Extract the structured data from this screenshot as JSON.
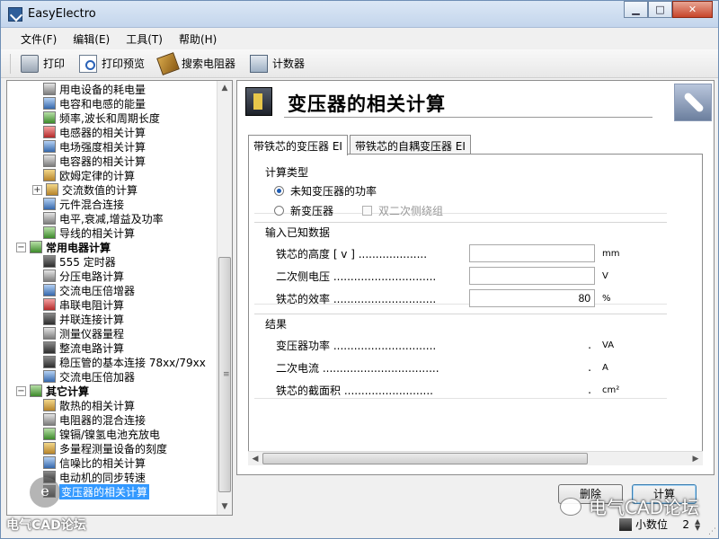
{
  "window": {
    "title": "EasyElectro"
  },
  "menu": [
    "文件(F)",
    "编辑(E)",
    "工具(T)",
    "帮助(H)"
  ],
  "toolbar": {
    "print": "打印",
    "print_preview": "打印预览",
    "search_resistor": "搜索电阻器",
    "counter": "计数器"
  },
  "tree": {
    "items_a": [
      "用电设备的耗电量",
      "电容和电感的能量",
      "频率,波长和周期长度",
      "电感器的相关计算",
      "电场强度相关计算",
      "电容器的相关计算",
      "欧姆定律的计算",
      "交流数值的计算",
      "元件混合连接",
      "电平,衰减,增益及功率",
      "导线的相关计算"
    ],
    "group_common": "常用电器计算",
    "items_b": [
      "555 定时器",
      "分压电路计算",
      "交流电压倍增器",
      "串联电阻计算",
      "并联连接计算",
      "测量仪器量程",
      "整流电路计算",
      "稳压管的基本连接 78xx/79xx",
      "交流电压倍加器"
    ],
    "group_other": "其它计算",
    "items_c": [
      "散热的相关计算",
      "电阻器的混合连接",
      "镍镉/镍氢电池充放电",
      "多量程测量设备的刻度",
      "信噪比的相关计算",
      "电动机的同步转速",
      "变压器的相关计算"
    ]
  },
  "page": {
    "title": "变压器的相关计算",
    "tabs": [
      "带铁芯的变压器 EI",
      "带铁芯的自耦变压器 EI"
    ],
    "calc_type": {
      "title": "计算类型",
      "option_known_power": "未知变压器的功率",
      "option_new": "新变压器",
      "option_dual_secondary": "双二次侧绕组"
    },
    "inputs": {
      "title": "输入已知数据",
      "rows": [
        {
          "label": "铁芯的高度 [ v ] ....................",
          "value": "",
          "unit": "mm"
        },
        {
          "label": "二次侧电压 ..............................",
          "value": "",
          "unit": "V"
        },
        {
          "label": "铁芯的效率 ..............................",
          "value": "80",
          "unit": "%"
        }
      ]
    },
    "results": {
      "title": "结果",
      "rows": [
        {
          "label": "变压器功率 ..............................",
          "value": ".",
          "unit": "VA"
        },
        {
          "label": "二次电流 ..................................",
          "value": ".",
          "unit": "A"
        },
        {
          "label": "铁芯的截面积 ..........................",
          "value": ".",
          "unit": "cm²"
        }
      ]
    }
  },
  "buttons": {
    "delete": "删除",
    "calculate": "计算"
  },
  "status": {
    "decimals_label": "小数位",
    "decimals_value": "2"
  },
  "watermark": {
    "text": "电气CAD论坛",
    "logo_letter": "e"
  }
}
